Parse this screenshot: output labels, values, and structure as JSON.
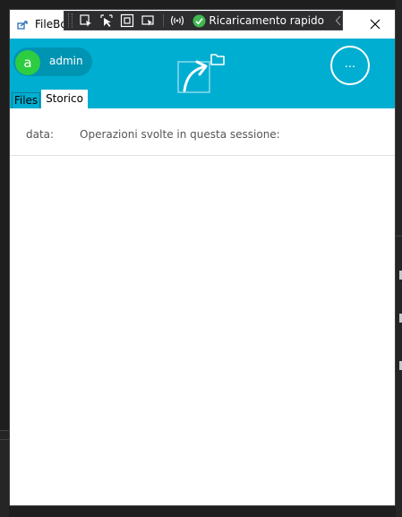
{
  "window": {
    "title": "FileBo",
    "close_label": "✕"
  },
  "debug_toolbar": {
    "hot_reload_label": "Ricaricamento rapido",
    "icons": [
      "select-element-icon",
      "display-adorners-icon",
      "track-focus-icon",
      "layout-adorners-icon",
      "hot-reload-status-icon"
    ]
  },
  "header": {
    "user_initial": "a",
    "username": "admin",
    "more_label": "...",
    "tabs": [
      {
        "label": "Files",
        "active": false
      },
      {
        "label": "Storico",
        "active": true
      }
    ]
  },
  "history": {
    "date_label": "data:",
    "operations_label": "Operazioni svolte in questa sessione:",
    "entries": []
  },
  "colors": {
    "header_bg": "#00aed1",
    "avatar_bg": "#2ecc40",
    "hot_reload_ok": "#3fb950"
  }
}
